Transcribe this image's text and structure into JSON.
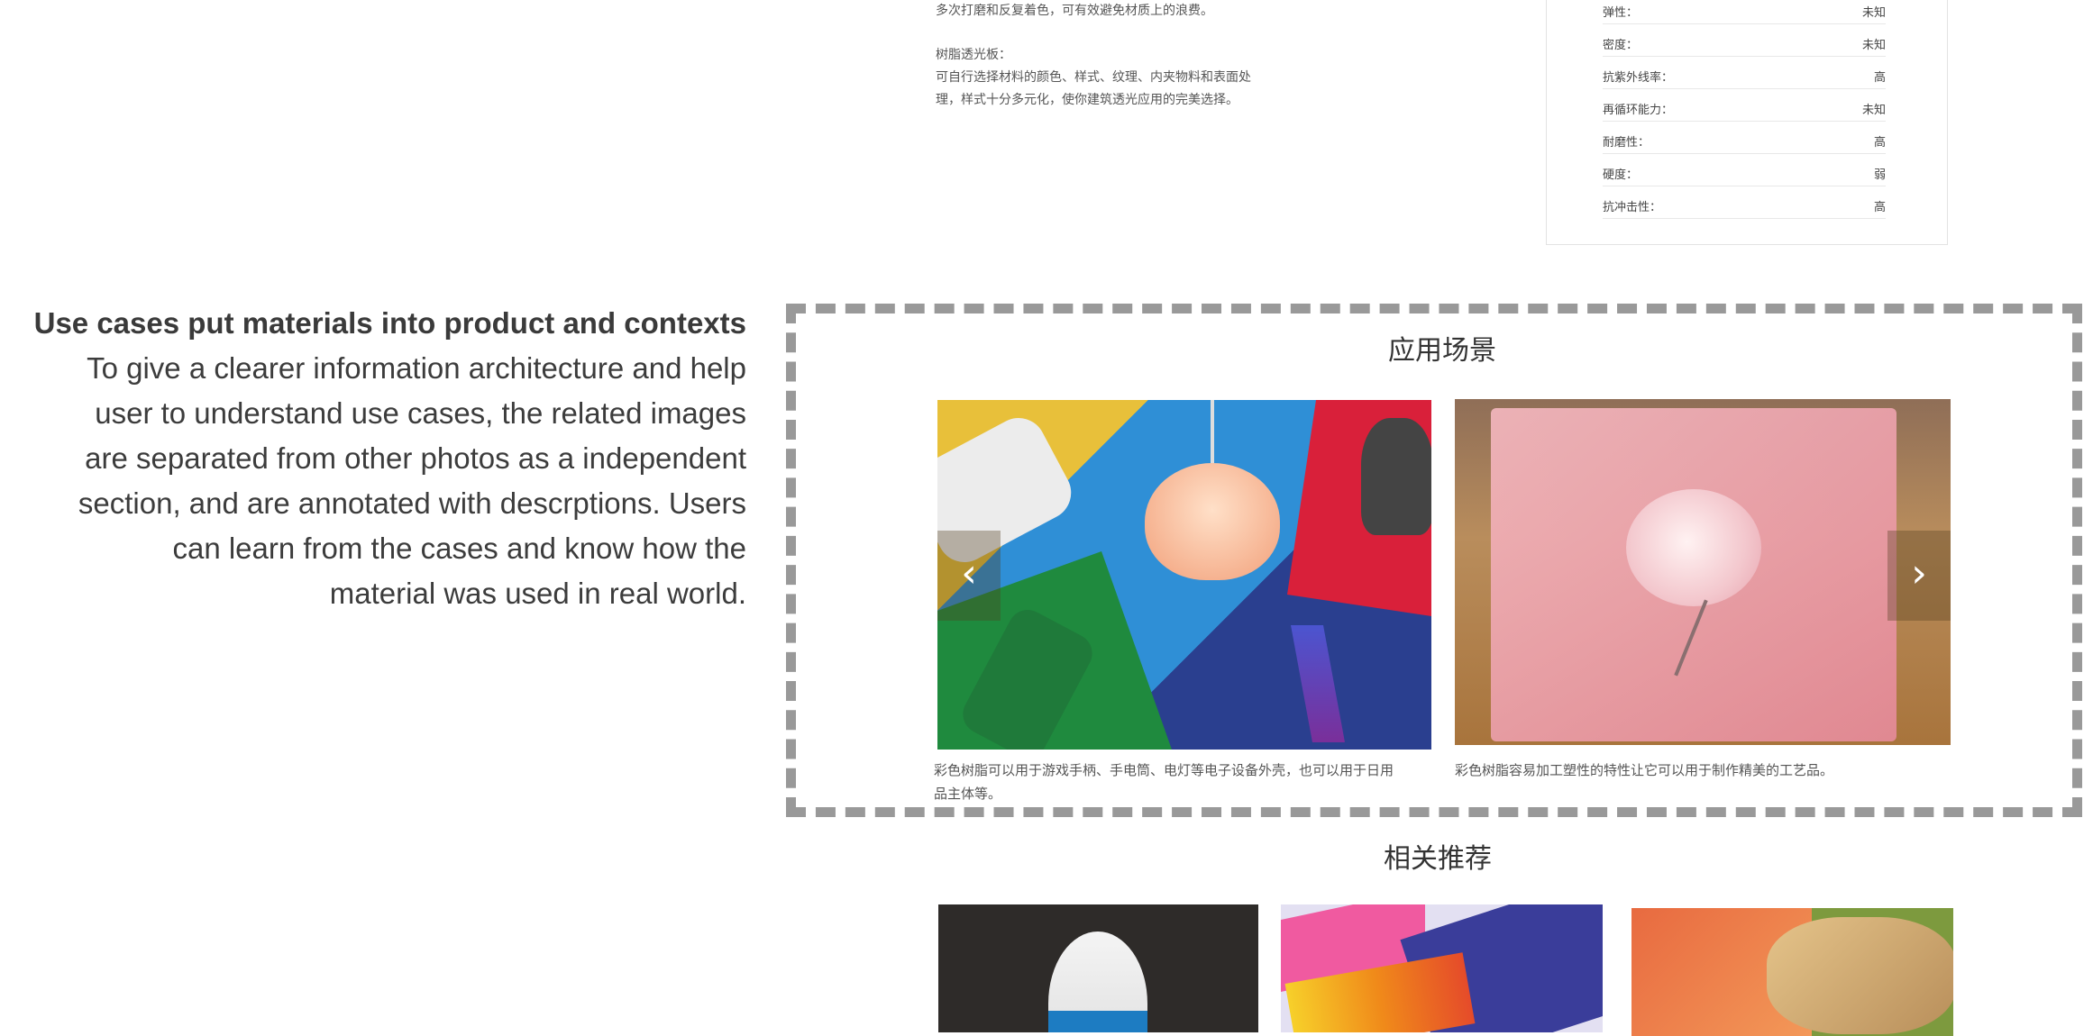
{
  "description": {
    "paragraph1": "多次打磨和反复着色，可有效避免材质上的浪费。",
    "heading2": "树脂透光板：",
    "paragraph2": "可自行选择材料的颜色、样式、纹理、内夹物料和表面处\n理，样式十分多元化，使你建筑透光应用的完美选择。"
  },
  "properties": [
    {
      "name": "弹性：",
      "value": "未知"
    },
    {
      "name": "密度：",
      "value": "未知"
    },
    {
      "name": "抗紫外线率：",
      "value": "高"
    },
    {
      "name": "再循环能力：",
      "value": "未知"
    },
    {
      "name": "耐磨性：",
      "value": "高"
    },
    {
      "name": "硬度：",
      "value": "弱"
    },
    {
      "name": "抗冲击性：",
      "value": "高"
    }
  ],
  "annotation": {
    "heading": "Use cases put materials into product and contexts",
    "lines": [
      "To give a clearer information architecture and help",
      "user to understand use cases, the related images",
      "are separated from other photos as a independent",
      "section, and are annotated with descrptions. Users",
      "can learn from the cases and know how the",
      "material was used in real world."
    ]
  },
  "scenes": {
    "title": "应用场景",
    "prev_icon": "‹",
    "next_icon": "›",
    "captions": [
      "彩色树脂可以用于游戏手柄、手电筒、电灯等电子设备外壳，也可以用于日用\n品主体等。",
      "彩色树脂容易加工塑性的特性让它可以用于制作精美的工艺品。"
    ]
  },
  "related": {
    "title": "相关推荐"
  },
  "colors": {
    "dash_border": "#999999",
    "text": "#444444"
  }
}
